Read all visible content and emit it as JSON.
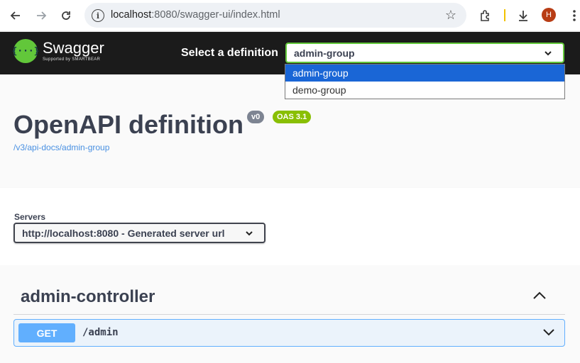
{
  "browser": {
    "url_host": "localhost",
    "url_rest": ":8080/swagger-ui/index.html",
    "avatar_letter": "H"
  },
  "topbar": {
    "logo_title": "Swagger",
    "logo_sub": "Supported by SMARTBEAR",
    "definition_label": "Select a definition",
    "definition_selected": "admin-group",
    "definition_options": [
      "admin-group",
      "demo-group"
    ]
  },
  "info": {
    "title": "OpenAPI definition",
    "version_badge": "v0",
    "oas_badge": "OAS 3.1",
    "doc_link": "/v3/api-docs/admin-group"
  },
  "servers": {
    "label": "Servers",
    "selected": "http://localhost:8080 - Generated server url"
  },
  "operations": {
    "tag_title": "admin-controller",
    "items": [
      {
        "method": "GET",
        "path": "/admin"
      }
    ]
  },
  "colors": {
    "swagger_green": "#62c73a",
    "topbar_bg": "#1b1b1b",
    "get_blue": "#61affe",
    "oas_green": "#89bf04"
  }
}
